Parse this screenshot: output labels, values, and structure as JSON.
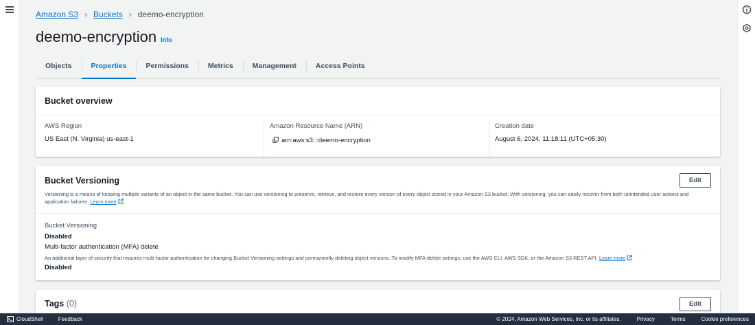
{
  "breadcrumb": {
    "root": "Amazon S3",
    "buckets": "Buckets",
    "current": "deemo-encryption"
  },
  "page": {
    "title": "deemo-encryption",
    "info": "Info"
  },
  "tabs": [
    {
      "label": "Objects"
    },
    {
      "label": "Properties"
    },
    {
      "label": "Permissions"
    },
    {
      "label": "Metrics"
    },
    {
      "label": "Management"
    },
    {
      "label": "Access Points"
    }
  ],
  "overview": {
    "title": "Bucket overview",
    "region_label": "AWS Region",
    "region_value": "US East (N. Virginia) us-east-1",
    "arn_label": "Amazon Resource Name (ARN)",
    "arn_value": "arn:aws:s3:::deemo-encryption",
    "created_label": "Creation date",
    "created_value": "August 6, 2024, 11:18:11 (UTC+05:30)"
  },
  "versioning": {
    "title": "Bucket Versioning",
    "edit": "Edit",
    "description": "Versioning is a means of keeping multiple variants of an object in the same bucket. You can use versioning to preserve, retrieve, and restore every version of every object stored in your Amazon S3 bucket. With versioning, you can easily recover from both unintended user actions and application failures.",
    "learn_more": "Learn more",
    "status_label": "Bucket Versioning",
    "status_value": "Disabled",
    "mfa_label": "Multi-factor authentication (MFA) delete",
    "mfa_description": "An additional layer of security that requires multi-factor authentication for changing Bucket Versioning settings and permanently deleting object versions. To modify MFA delete settings, use the AWS CLI, AWS SDK, or the Amazon S3 REST API.",
    "mfa_learn_more": "Learn more",
    "mfa_value": "Disabled"
  },
  "tags": {
    "title": "Tags",
    "count": "(0)",
    "edit": "Edit"
  },
  "footer": {
    "cloudshell": "CloudShell",
    "feedback": "Feedback",
    "copyright": "© 2024, Amazon Web Services, Inc. or its affiliates.",
    "privacy": "Privacy",
    "terms": "Terms",
    "cookies": "Cookie preferences"
  },
  "colors": {
    "link": "#0972d3",
    "footer_bg": "#232f3e",
    "page_bg": "#f2f3f3"
  }
}
